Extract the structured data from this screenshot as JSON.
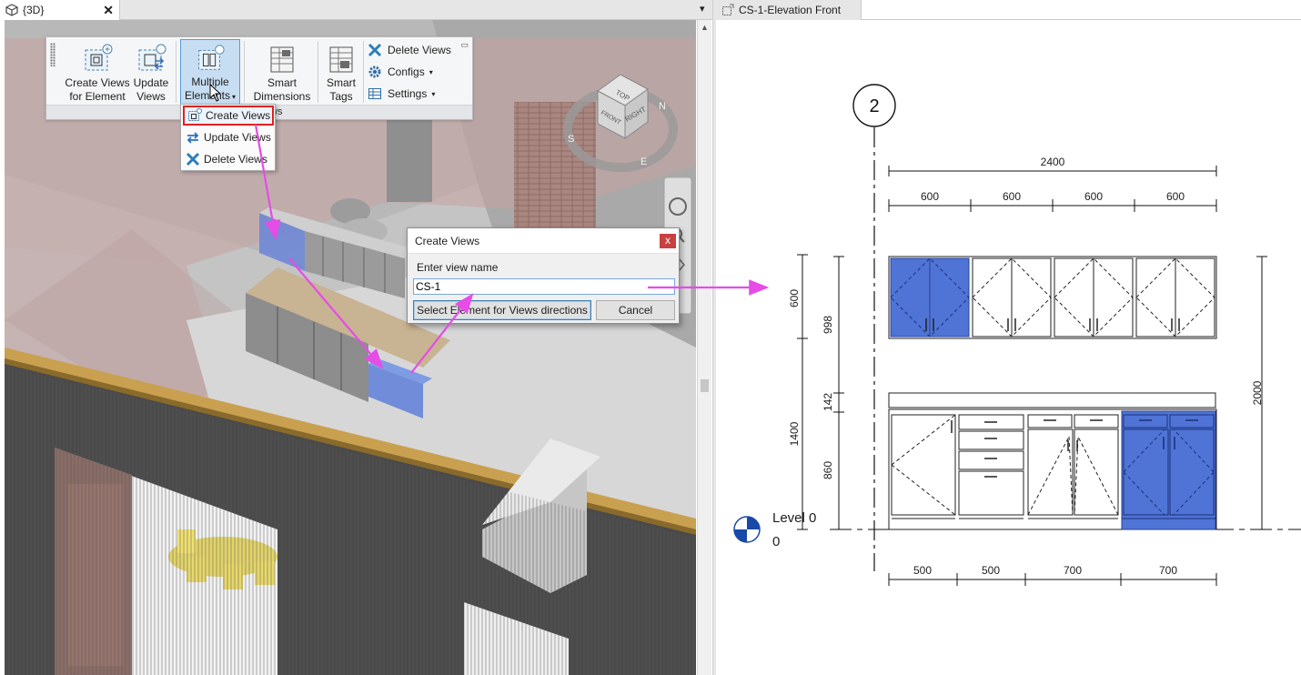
{
  "tabs": {
    "view3d": {
      "label": "{3D}",
      "close": "✕",
      "menu_caret": "▾"
    },
    "elevation": {
      "label": "CS-1-Elevation Front"
    }
  },
  "ribbon": {
    "buttons": [
      {
        "id": "create-views-for-element",
        "line1": "Create Views",
        "line2": "for Element",
        "icon": "create-views-icon"
      },
      {
        "id": "update-views",
        "line1": "Update",
        "line2": "Views",
        "icon": "update-views-icon"
      },
      {
        "id": "multiple-elements",
        "line1": "Multiple",
        "line2": "Elements",
        "icon": "multiple-elements-icon"
      },
      {
        "id": "smart-dimensions",
        "line1": "Smart",
        "line2": "Dimensions",
        "icon": "smart-dimensions-icon"
      },
      {
        "id": "smart-tags",
        "line1": "Smart",
        "line2": "Tags",
        "icon": "smart-tags-icon"
      }
    ],
    "small_buttons": [
      {
        "label": "Delete Views",
        "icon": "delete-x-icon",
        "caret": false
      },
      {
        "label": "Configs",
        "icon": "gear-icon",
        "caret": true
      },
      {
        "label": "Settings",
        "icon": "settings-table-icon",
        "caret": true
      }
    ],
    "panel_label": "ws",
    "caret_glyph": "▾"
  },
  "dropdown": {
    "items": [
      {
        "label": "Create Views",
        "icon": "create-views-icon",
        "highlighted": true
      },
      {
        "label": "Update  Views",
        "icon": "update-arrows-icon",
        "highlighted": false
      },
      {
        "label": "Delete Views",
        "icon": "delete-x-icon",
        "highlighted": false
      }
    ]
  },
  "dialog": {
    "title": "Create Views",
    "close": "x",
    "prompt": "Enter view name",
    "value": "CS-1",
    "select_button": "Select Element for Views directions",
    "cancel_button": "Cancel"
  },
  "viewcube": {
    "faces": [
      "TOP",
      "RIGHT",
      "FRONT"
    ],
    "compass": [
      "S",
      "E",
      "N"
    ]
  },
  "elevation": {
    "grid_bubble": "2",
    "level_name": "Level 0",
    "level_value": "0",
    "dims_top_total": "2400",
    "dims_top": [
      "600",
      "600",
      "600",
      "600"
    ],
    "dims_bottom": [
      "500",
      "500",
      "700",
      "700"
    ],
    "dims_left_outer": [
      "600",
      "1400"
    ],
    "dims_left_inner": [
      "998",
      "142",
      "860"
    ],
    "dims_right": "2000"
  },
  "colors": {
    "highlight_blue": "#4f74d6",
    "arrow_magenta": "#e64ce6",
    "dropdown_highlight_border": "#e02020",
    "active_button_bg": "#c7ddf2"
  }
}
